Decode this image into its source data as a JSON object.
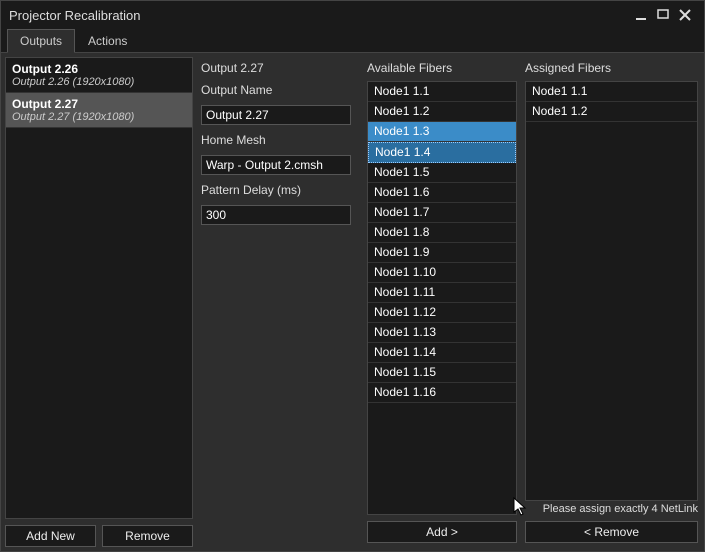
{
  "window": {
    "title": "Projector Recalibration"
  },
  "tabs": {
    "outputs": "Outputs",
    "actions": "Actions"
  },
  "outputs": [
    {
      "name": "Output 2.26",
      "res": "Output 2.26 (1920x1080)",
      "selected": false
    },
    {
      "name": "Output 2.27",
      "res": "Output 2.27 (1920x1080)",
      "selected": true
    }
  ],
  "left_buttons": {
    "add_new": "Add New",
    "remove": "Remove"
  },
  "form": {
    "heading": "Output 2.27",
    "name_label": "Output Name",
    "name_value": "Output 2.27",
    "mesh_label": "Home Mesh",
    "mesh_value": "Warp - Output 2.cmsh",
    "delay_label": "Pattern Delay (ms)",
    "delay_value": "300"
  },
  "fibers": {
    "available_label": "Available Fibers",
    "assigned_label": "Assigned Fibers",
    "available": [
      {
        "label": "Node1 1.1"
      },
      {
        "label": "Node1 1.2"
      },
      {
        "label": "Node1 1.3",
        "sel": "secondary"
      },
      {
        "label": "Node1 1.4",
        "sel": "primary"
      },
      {
        "label": "Node1 1.5"
      },
      {
        "label": "Node1 1.6"
      },
      {
        "label": "Node1 1.7"
      },
      {
        "label": "Node1 1.8"
      },
      {
        "label": "Node1 1.9"
      },
      {
        "label": "Node1 1.10"
      },
      {
        "label": "Node1 1.11"
      },
      {
        "label": "Node1 1.12"
      },
      {
        "label": "Node1 1.13"
      },
      {
        "label": "Node1 1.14"
      },
      {
        "label": "Node1 1.15"
      },
      {
        "label": "Node1 1.16"
      }
    ],
    "assigned": [
      {
        "label": "Node1 1.1"
      },
      {
        "label": "Node1 1.2"
      }
    ],
    "hint": "Please assign exactly 4 NetLink",
    "add_btn": "Add >",
    "remove_btn": "< Remove"
  }
}
